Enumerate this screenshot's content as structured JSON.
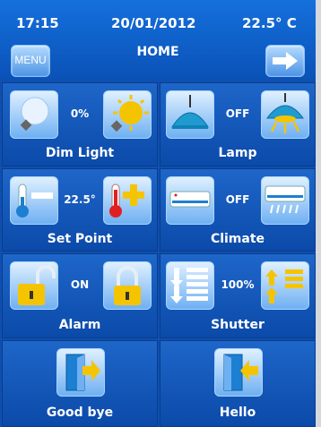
{
  "status": {
    "time": "17:15",
    "date": "20/01/2012",
    "temperature": "22.5° C"
  },
  "header": {
    "title": "HOME",
    "menu_label": "MENU"
  },
  "tiles": [
    {
      "label": "Dim Light",
      "value": "0%"
    },
    {
      "label": "Lamp",
      "value": "OFF"
    },
    {
      "label": "Set Point",
      "value": "22.5°"
    },
    {
      "label": "Climate",
      "value": "OFF"
    },
    {
      "label": "Alarm",
      "value": "ON"
    },
    {
      "label": "Shutter",
      "value": "100%"
    },
    {
      "label": "Good bye"
    },
    {
      "label": "Hello"
    }
  ],
  "colors": {
    "background": "#0f4fb0",
    "accent_yellow": "#f5c400",
    "button_blue": "#6fb0f2"
  }
}
